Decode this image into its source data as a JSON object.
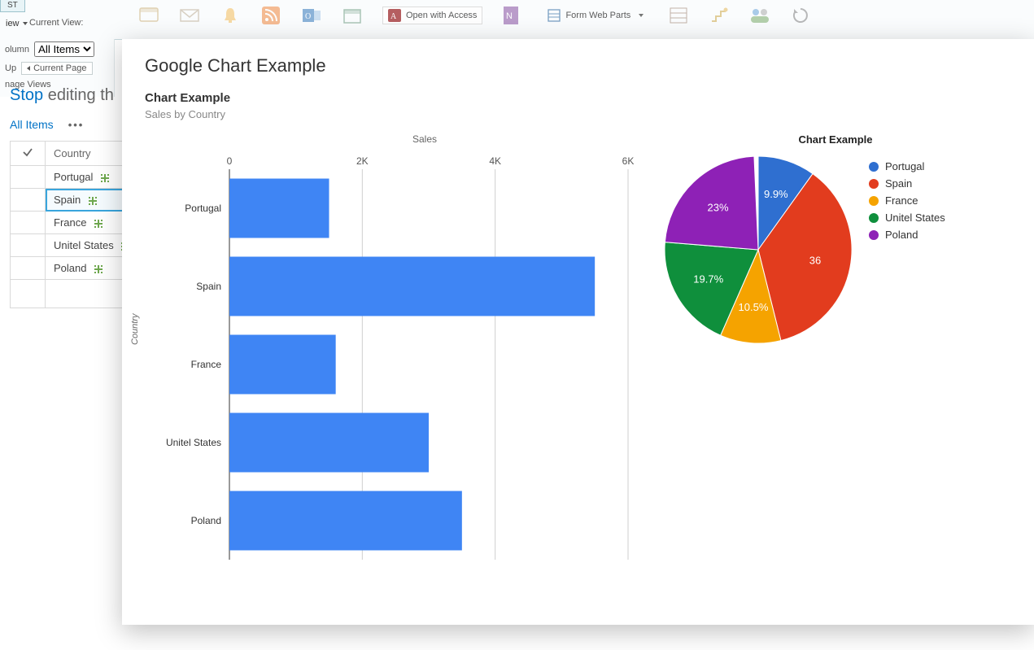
{
  "ribbon": {
    "tab_label": "ST",
    "view_label": "iew",
    "current_view_label": "Current View:",
    "column_label": "olumn",
    "all_items_option": "All Items",
    "up_label": "Up",
    "current_page_label": "Current Page",
    "manage_views_label": "nage Views",
    "open_with_access": "Open with Access",
    "form_web_parts": "Form Web Parts"
  },
  "sidebar": {
    "stop_word": "Stop",
    "editing_text": " editing th",
    "all_items_link": "All Items",
    "country_header": "Country",
    "rows": [
      "Portugal",
      "Spain",
      "France",
      "Unitel States",
      "Poland"
    ],
    "selected_index": 1
  },
  "popup": {
    "title": "Google Chart Example",
    "subtitle": "Chart Example",
    "subtext": "Sales by Country",
    "bar_axis_title": "Sales",
    "bar_cat_title": "Country",
    "pie_title": "Chart Example"
  },
  "chart_data": [
    {
      "type": "bar",
      "orientation": "horizontal",
      "title": "Sales",
      "ylabel": "Country",
      "xlabel": "Sales",
      "xlim": [
        0,
        6000
      ],
      "xticks": [
        0,
        2000,
        4000,
        6000
      ],
      "xtick_labels": [
        "0",
        "2K",
        "4K",
        "6K"
      ],
      "categories": [
        "Portugal",
        "Spain",
        "France",
        "Unitel States",
        "Poland"
      ],
      "values": [
        1500,
        5500,
        1600,
        3000,
        3500
      ],
      "bar_color": "#3f85f4"
    },
    {
      "type": "pie",
      "title": "Chart Example",
      "series": [
        {
          "name": "Portugal",
          "percent": 9.9,
          "color": "#2f6fd0"
        },
        {
          "name": "Spain",
          "percent": 36.2,
          "color": "#e23c1e"
        },
        {
          "name": "France",
          "percent": 10.5,
          "color": "#f5a300"
        },
        {
          "name": "Unitel States",
          "percent": 19.7,
          "color": "#0f8f3c"
        },
        {
          "name": "Poland",
          "percent": 23.0,
          "color": "#8e21b6"
        }
      ],
      "labels_shown": {
        "Portugal": "9.9%",
        "France": "10.5%",
        "Unitel States": "19.7%",
        "Poland": "23%",
        "Spain": "36"
      }
    }
  ]
}
